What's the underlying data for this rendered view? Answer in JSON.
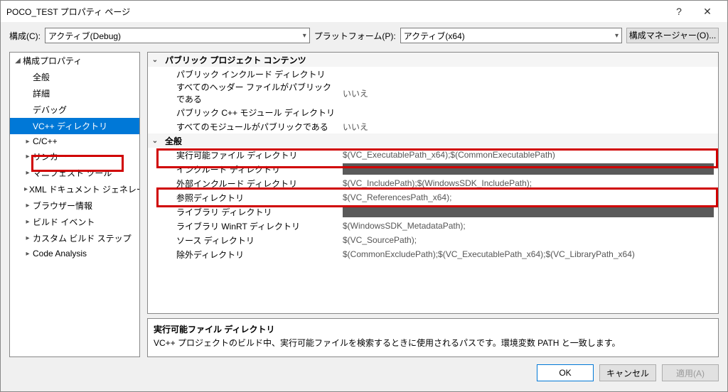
{
  "window": {
    "title": "POCO_TEST プロパティ ページ"
  },
  "config": {
    "label_config": "構成(C):",
    "value_config": "アクティブ(Debug)",
    "label_platform": "プラットフォーム(P):",
    "value_platform": "アクティブ(x64)",
    "manager_button": "構成マネージャー(O)..."
  },
  "tree": {
    "root": "構成プロパティ",
    "items": [
      "全般",
      "詳細",
      "デバッグ",
      "VC++ ディレクトリ",
      "C/C++",
      "リンカー",
      "マニフェスト ツール",
      "XML ドキュメント ジェネレーター",
      "ブラウザー情報",
      "ビルド イベント",
      "カスタム ビルド ステップ",
      "Code Analysis"
    ],
    "expanders": [
      "",
      "",
      "",
      "",
      "▸",
      "▸",
      "▸",
      "▸",
      "▸",
      "▸",
      "▸",
      "▸"
    ]
  },
  "grid": {
    "group1": "パブリック プロジェクト コンテンツ",
    "rows1": [
      {
        "label": "パブリック インクルード ディレクトリ",
        "value": ""
      },
      {
        "label": "すべてのヘッダー ファイルがパブリックである",
        "value": "いいえ"
      },
      {
        "label": "パブリック C++ モジュール ディレクトリ",
        "value": ""
      },
      {
        "label": "すべてのモジュールがパブリックである",
        "value": "いいえ"
      }
    ],
    "group2": "全般",
    "rows2": [
      {
        "label": "実行可能ファイル ディレクトリ",
        "value": "$(VC_ExecutablePath_x64);$(CommonExecutablePath)"
      },
      {
        "label": "インクルード ディレクトリ",
        "value": "",
        "redacted": true
      },
      {
        "label": "外部インクルード ディレクトリ",
        "value": "$(VC_IncludePath);$(WindowsSDK_IncludePath);"
      },
      {
        "label": "参照ディレクトリ",
        "value": "$(VC_ReferencesPath_x64);"
      },
      {
        "label": "ライブラリ ディレクトリ",
        "value": "",
        "redacted": true
      },
      {
        "label": "ライブラリ WinRT ディレクトリ",
        "value": "$(WindowsSDK_MetadataPath);"
      },
      {
        "label": "ソース ディレクトリ",
        "value": "$(VC_SourcePath);"
      },
      {
        "label": "除外ディレクトリ",
        "value": "$(CommonExcludePath);$(VC_ExecutablePath_x64);$(VC_LibraryPath_x64)"
      }
    ]
  },
  "desc": {
    "title": "実行可能ファイル ディレクトリ",
    "text": "VC++ プロジェクトのビルド中、実行可能ファイルを検索するときに使用されるパスです。環境変数 PATH と一致します。"
  },
  "buttons": {
    "ok": "OK",
    "cancel": "キャンセル",
    "apply": "適用(A)"
  }
}
